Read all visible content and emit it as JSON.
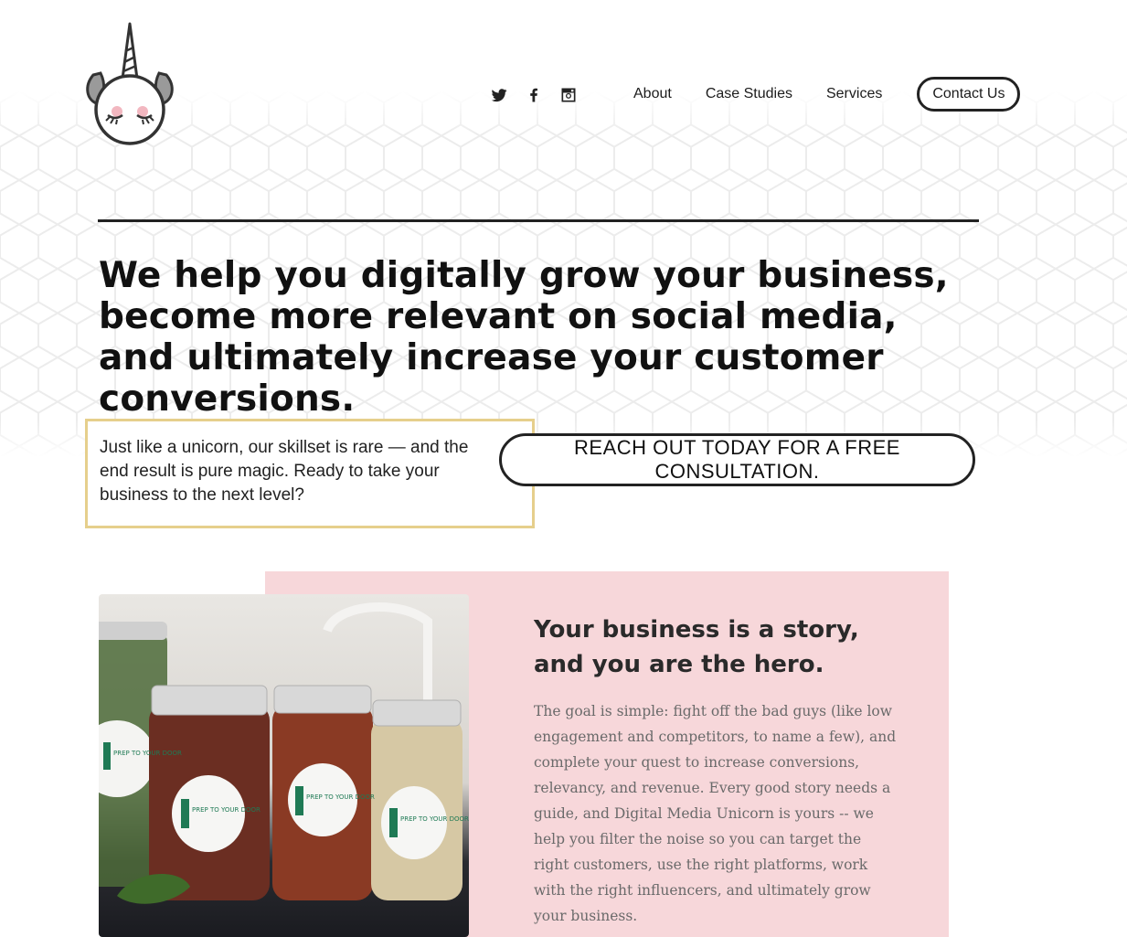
{
  "header": {
    "social": [
      {
        "icon": "twitter-icon"
      },
      {
        "icon": "facebook-icon"
      },
      {
        "icon": "instagram-icon"
      }
    ],
    "nav": [
      {
        "label": "About"
      },
      {
        "label": "Case Studies"
      },
      {
        "label": "Services"
      }
    ],
    "contact_label": "Contact Us"
  },
  "hero": {
    "headline": "We help you digitally grow your business, become more relevant on social media, and ultimately increase your customer conversions.",
    "intro": "Just like a unicorn, our skillset is rare — and the end result is pure magic. Ready to take your business to the next level?",
    "cta_label": "REACH OUT TODAY FOR A FREE CONSULTATION."
  },
  "story": {
    "title_line1": "Your business is a story,",
    "title_line2": "and you are the hero.",
    "body": "The goal is simple: fight off the bad guys (like low engagement and competitors, to name a few), and complete your quest to increase conversions, relevancy, and revenue. Every good story needs a guide, and Digital Media Unicorn is yours -- we help you filter the noise so you can target the right customers, use the right platforms, work with the right influencers, and ultimately grow your business.",
    "jar_label": "PREP TO YOUR DOOR"
  },
  "colors": {
    "accent_pink": "#f7d7da",
    "box_border_gold": "#e6cf8c",
    "dark": "#222222"
  }
}
